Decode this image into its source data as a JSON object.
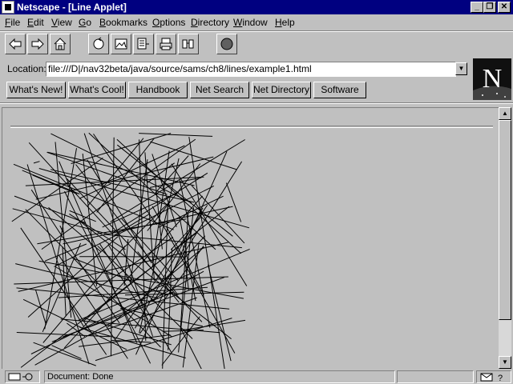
{
  "window": {
    "title": "Netscape - [Line Applet]",
    "minimize": "_",
    "restore": "❐",
    "close": "✕"
  },
  "menu": [
    {
      "u": "F",
      "rest": "ile"
    },
    {
      "u": "E",
      "rest": "dit"
    },
    {
      "u": "V",
      "rest": "iew"
    },
    {
      "u": "G",
      "rest": "o"
    },
    {
      "u": "B",
      "rest": "ookmarks"
    },
    {
      "u": "O",
      "rest": "ptions"
    },
    {
      "u": "D",
      "rest": "irectory"
    },
    {
      "u": "W",
      "rest": "indow"
    },
    {
      "u": "H",
      "rest": "elp"
    }
  ],
  "toolbar": {
    "icons": [
      "back-icon",
      "forward-icon",
      "home-icon",
      "reload-icon",
      "images-icon",
      "open-icon",
      "print-icon",
      "find-icon",
      "stop-icon"
    ]
  },
  "location": {
    "label": "Location:",
    "url": "file:///D|/nav32beta/java/source/sams/ch8/lines/example1.html",
    "dropdown": "▼"
  },
  "directory_buttons": [
    "What's New!",
    "What's Cool!",
    "Handbook",
    "Net Search",
    "Net Directory",
    "Software"
  ],
  "logo_letter": "N",
  "scroll": {
    "up": "▲",
    "down": "▼"
  },
  "status": {
    "text": "Document: Done",
    "icons": [
      "security-key-icon",
      "mail-icon",
      "help-icon"
    ]
  },
  "colors": {
    "titlebar": "#000080",
    "face": "#c0c0c0",
    "line": "#000000"
  }
}
